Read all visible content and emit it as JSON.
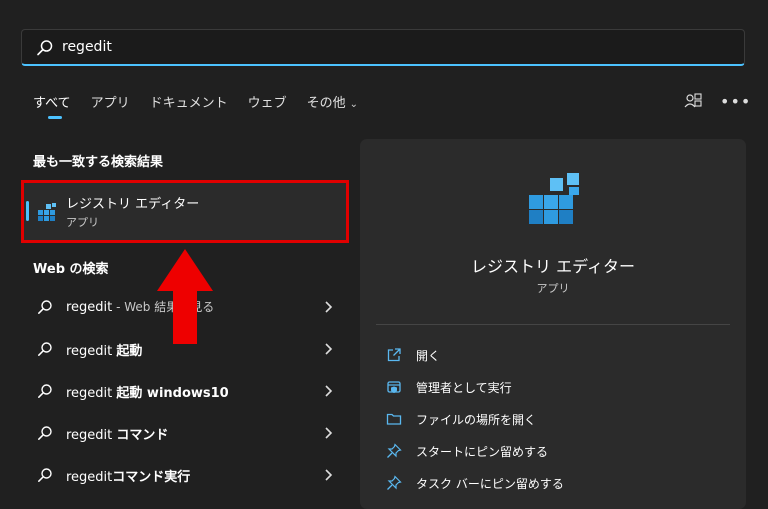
{
  "search": {
    "value": "regedit"
  },
  "tabs": [
    {
      "label": "すべて",
      "active": true
    },
    {
      "label": "アプリ"
    },
    {
      "label": "ドキュメント"
    },
    {
      "label": "ウェブ"
    },
    {
      "label": "その他",
      "has_dropdown": true
    }
  ],
  "toolbar": {
    "account_icon": "account-switch-icon",
    "more_icon": "more-options-icon"
  },
  "best_match": {
    "section_title": "最も一致する検索結果",
    "title": "レジストリ エディター",
    "subtitle": "アプリ",
    "icon": "registry-editor-icon"
  },
  "web": {
    "section_title": "Web の検索",
    "results": [
      {
        "text": "regedit",
        "bold": "",
        "suffix": " - Web 結果を見る"
      },
      {
        "text": "regedit ",
        "bold": "起動",
        "suffix": ""
      },
      {
        "text": "regedit ",
        "bold": "起動 windows10",
        "suffix": ""
      },
      {
        "text": "regedit ",
        "bold": "コマンド",
        "suffix": ""
      },
      {
        "text": "regedit",
        "bold": "コマンド実行",
        "suffix": ""
      }
    ]
  },
  "detail": {
    "title": "レジストリ エディター",
    "subtitle": "アプリ",
    "actions": [
      {
        "label": "開く",
        "icon": "open-icon"
      },
      {
        "label": "管理者として実行",
        "icon": "admin-shield-icon"
      },
      {
        "label": "ファイルの場所を開く",
        "icon": "folder-icon"
      },
      {
        "label": "スタートにピン留めする",
        "icon": "pin-icon"
      },
      {
        "label": "タスク バーにピン留めする",
        "icon": "pin-icon"
      }
    ]
  },
  "colors": {
    "accent": "#4cc2ff",
    "highlight_border": "#e00000",
    "arrow": "#ee0000",
    "background": "#202020",
    "panel": "#2b2b2b"
  }
}
